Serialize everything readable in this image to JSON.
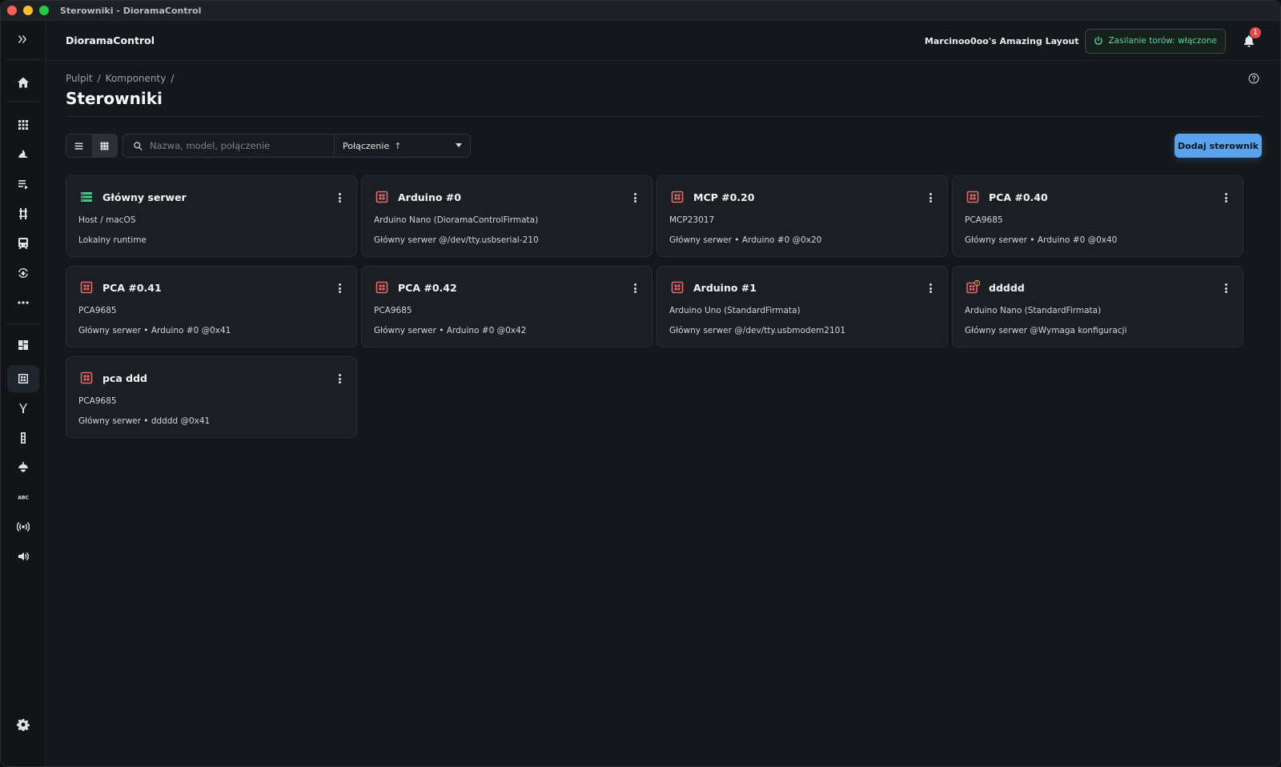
{
  "window": {
    "title": "Sterowniki - DioramaControl"
  },
  "header": {
    "app_name": "DioramaControl",
    "layout_name": "Marcinoo0oo's Amazing Layout",
    "power_status": "Zasilanie torów: włączone",
    "notification_count": "1"
  },
  "breadcrumb": {
    "items": [
      "Pulpit",
      "Komponenty"
    ],
    "separator": "/"
  },
  "page_title": "Sterowniki",
  "toolbar": {
    "search_placeholder": "Nazwa, model, połączenie",
    "sort_label": "Połączenie",
    "sort_arrow": "↑",
    "add_button": "Dodaj sterownik"
  },
  "colors": {
    "accent": "#5aa2ec",
    "power_green": "#5fd39a",
    "device_red": "#e56a6a",
    "server_green": "#4cc38a",
    "warning": "#e5a04a"
  },
  "cards": [
    {
      "name": "Główny serwer",
      "icon": "server-icon",
      "line1": "Host / macOS",
      "line2": "Lokalny runtime"
    },
    {
      "name": "Arduino #0",
      "icon": "board-icon",
      "line1": "Arduino Nano (DioramaControlFirmata)",
      "line2": "Główny serwer @/dev/tty.usbserial-210"
    },
    {
      "name": "MCP #0.20",
      "icon": "board-icon",
      "line1": "MCP23017",
      "line2": "Główny serwer • Arduino #0 @0x20"
    },
    {
      "name": "PCA #0.40",
      "icon": "board-icon",
      "line1": "PCA9685",
      "line2": "Główny serwer • Arduino #0 @0x40"
    },
    {
      "name": "PCA #0.41",
      "icon": "board-icon",
      "line1": "PCA9685",
      "line2": "Główny serwer • Arduino #0 @0x41"
    },
    {
      "name": "PCA #0.42",
      "icon": "board-icon",
      "line1": "PCA9685",
      "line2": "Główny serwer • Arduino #0 @0x42"
    },
    {
      "name": "Arduino #1",
      "icon": "board-icon",
      "line1": "Arduino Uno (StandardFirmata)",
      "line2": "Główny serwer @/dev/tty.usbmodem2101"
    },
    {
      "name": "ddddd",
      "icon": "board-warning-icon",
      "line1": "Arduino Nano (StandardFirmata)",
      "line2": "Główny serwer @Wymaga konfiguracji"
    },
    {
      "name": "pca ddd",
      "icon": "board-icon",
      "line1": "PCA9685",
      "line2": "Główny serwer • ddddd @0x41"
    }
  ]
}
